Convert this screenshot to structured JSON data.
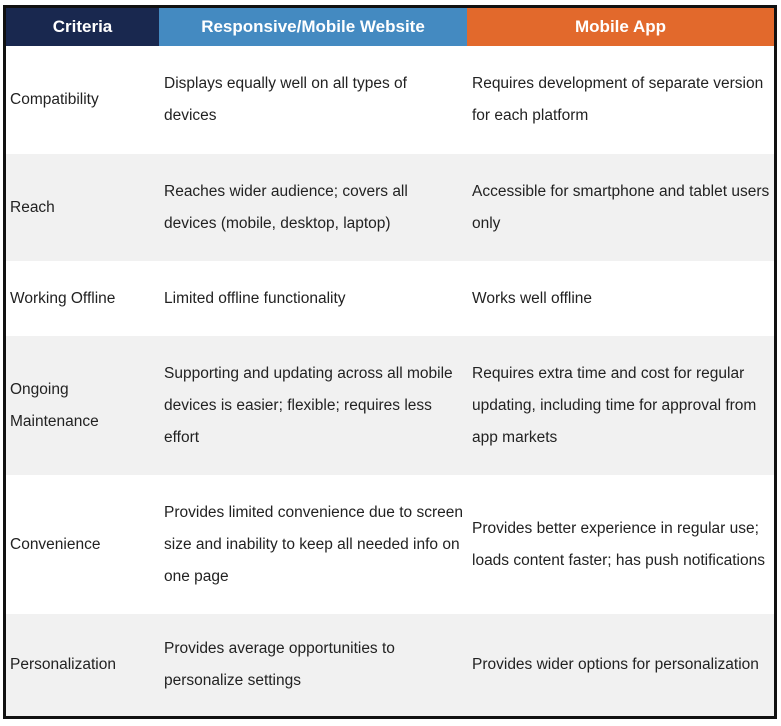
{
  "table": {
    "headers": {
      "criteria": "Criteria",
      "website": "Responsive/Mobile Website",
      "app": "Mobile App"
    },
    "header_colors": {
      "criteria": "#19284f",
      "website": "#448ac1",
      "app": "#e2692c"
    },
    "rows": [
      {
        "criteria": "Compatibility",
        "website": "Displays equally well on all types of devices",
        "app": "Requires development of separate version for each platform"
      },
      {
        "criteria": "Reach",
        "website": "Reaches wider audience; covers all devices (mobile, desktop, laptop)",
        "app": "Accessible for smartphone and tablet users only"
      },
      {
        "criteria": "Working Offline",
        "website": "Limited offline functionality",
        "app": "Works well offline"
      },
      {
        "criteria": "Ongoing Maintenance",
        "website": "Supporting and updating across all mobile devices is easier; flexible; requires less effort",
        "app": "Requires extra time and cost for regular updating, including time for approval from app markets"
      },
      {
        "criteria": "Convenience",
        "website": "Provides limited convenience due to screen size and inability to keep all needed info on one page",
        "app": "Provides better experience in regular use; loads content faster; has push notifications"
      },
      {
        "criteria": "Personalization",
        "website": "Provides average opportunities to personalize settings",
        "app": "Provides wider options for personalization"
      }
    ]
  }
}
